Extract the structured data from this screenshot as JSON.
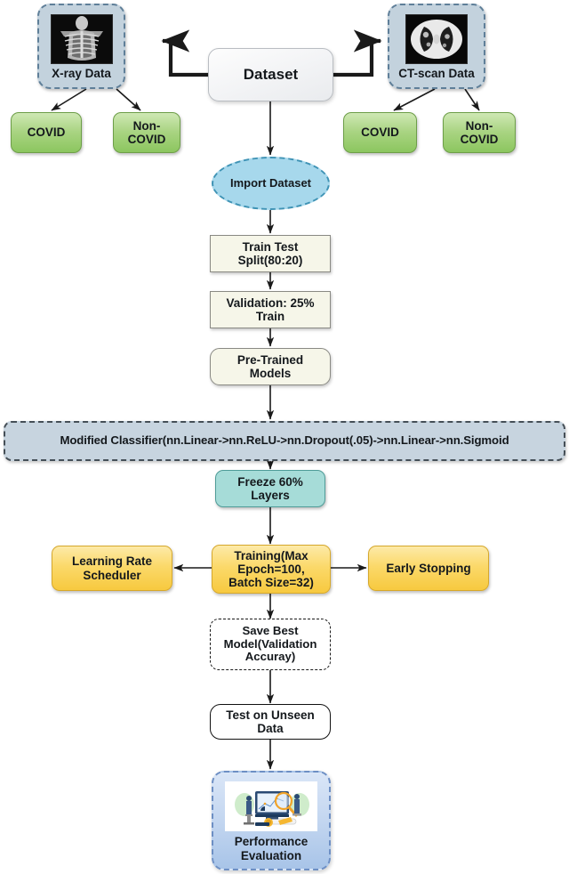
{
  "diagram": {
    "title": "COVID classification deep-learning pipeline flowchart",
    "nodes": {
      "dataset": {
        "label": "Dataset"
      },
      "xray": {
        "label": "X-ray Data",
        "image": "chest-xray-thumbnail"
      },
      "ct": {
        "label": "CT-scan Data",
        "image": "chest-ct-scan-thumbnail"
      },
      "xray_covid": {
        "label": "COVID"
      },
      "xray_noncovid": {
        "label": "Non-COVID"
      },
      "ct_covid": {
        "label": "COVID"
      },
      "ct_noncovid": {
        "label": "Non-COVID"
      },
      "import": {
        "label": "Import Dataset"
      },
      "split": {
        "label": "Train Test Split(80:20)"
      },
      "validation": {
        "label": "Validation: 25% Train"
      },
      "pretrained": {
        "label": "Pre-Trained Models"
      },
      "classifier": {
        "label": "Modified Classifier(nn.Linear->nn.ReLU->nn.Dropout(.05)->nn.Linear->nn.Sigmoid"
      },
      "freeze": {
        "label": "Freeze 60% Layers"
      },
      "training": {
        "label": "Training(Max Epoch=100, Batch Size=32)"
      },
      "lr_scheduler": {
        "label": "Learning Rate Scheduler"
      },
      "early_stopping": {
        "label": "Early Stopping"
      },
      "save_best": {
        "label": "Save Best Model(Validation Accuray)"
      },
      "test_unseen": {
        "label": "Test on Unseen Data"
      },
      "performance": {
        "label": "Performance Evaluation",
        "image": "data-analytics-illustration"
      }
    },
    "node_lines": {
      "split": [
        "Train Test",
        "Split(80:20)"
      ],
      "validation": [
        "Validation: 25%",
        "Train"
      ],
      "pretrained": [
        "Pre-Trained",
        "Models"
      ],
      "freeze": [
        "Freeze 60%",
        "Layers"
      ],
      "training": [
        "Training(Max",
        "Epoch=100,",
        "Batch Size=32)"
      ],
      "lr_scheduler": [
        "Learning Rate",
        "Scheduler"
      ],
      "save_best": [
        "Save Best",
        "Model(Validation",
        "Accuray)"
      ],
      "test_unseen": [
        "Test on Unseen",
        "Data"
      ],
      "performance": [
        "Performance",
        "Evaluation"
      ],
      "xray_noncovid": [
        "Non-",
        "COVID"
      ],
      "ct_noncovid": [
        "Non-",
        "COVID"
      ]
    },
    "colors": {
      "modality_fill": "#c3d2dd",
      "green_fill": "#a9d482",
      "ellipse_fill": "#a7d8ec",
      "cream_fill": "#f6f6e9",
      "classifier_fill": "#c7d4df",
      "teal_fill": "#a6dcd8",
      "yellow_fill": "#fbd96a",
      "performance_fill": "#c3d6f0",
      "arrow_stroke": "#1a1a1a",
      "text": "#14181c"
    }
  }
}
